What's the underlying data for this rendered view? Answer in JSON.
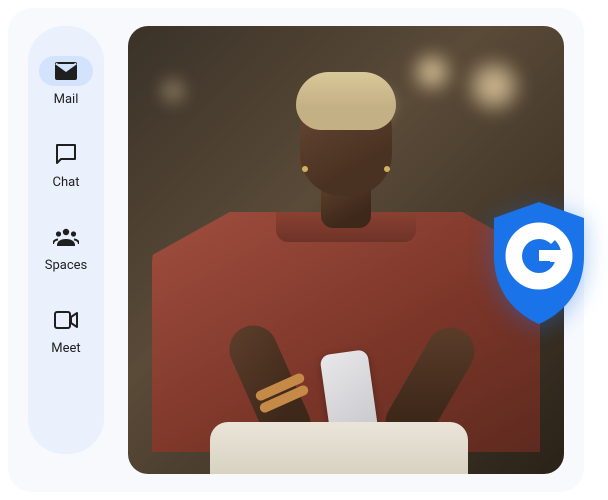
{
  "sidebar": {
    "items": [
      {
        "id": "mail",
        "label": "Mail",
        "icon": "mail-icon",
        "active": true
      },
      {
        "id": "chat",
        "label": "Chat",
        "icon": "chat-icon",
        "active": false
      },
      {
        "id": "spaces",
        "label": "Spaces",
        "icon": "spaces-icon",
        "active": false
      },
      {
        "id": "meet",
        "label": "Meet",
        "icon": "meet-icon",
        "active": false
      }
    ]
  },
  "badge": {
    "letter": "G",
    "name": "google-shield"
  },
  "colors": {
    "sidebar_bg": "#eaf0fc",
    "active_pill": "#d3e3fd",
    "shield": "#1a73e8"
  }
}
